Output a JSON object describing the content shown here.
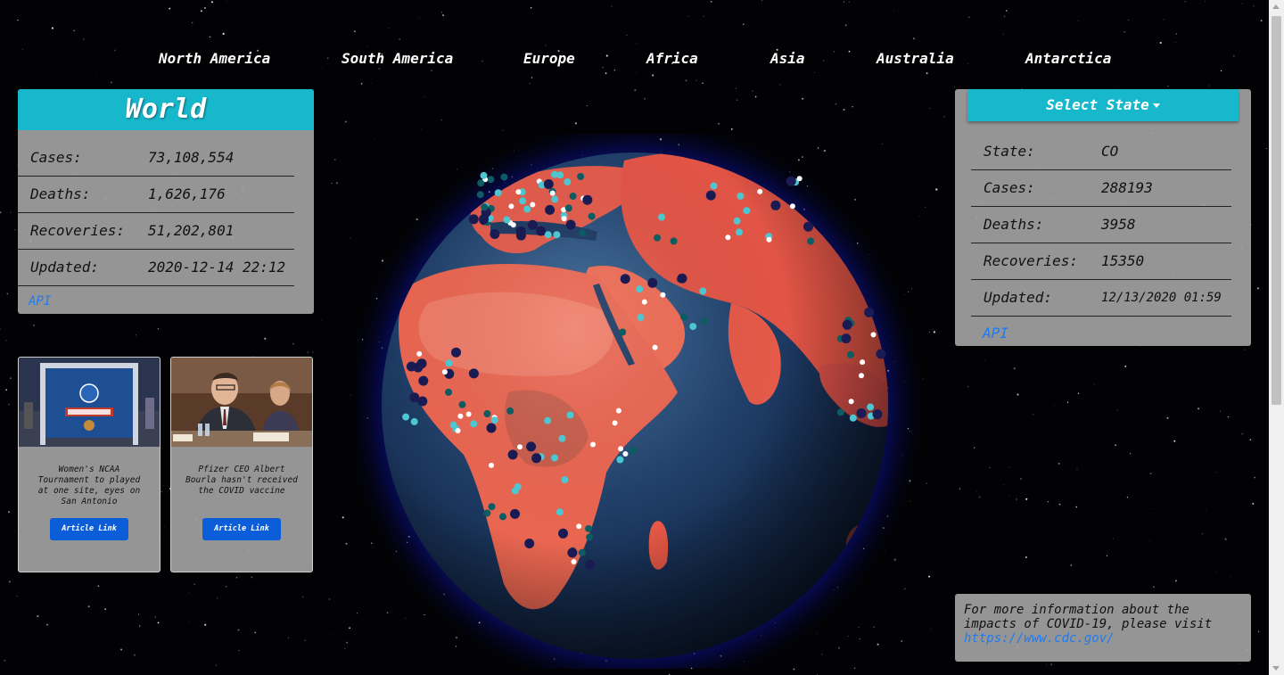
{
  "nav": {
    "items": [
      {
        "label": "North America"
      },
      {
        "label": "South America"
      },
      {
        "label": "Europe"
      },
      {
        "label": "Africa"
      },
      {
        "label": "Asia"
      },
      {
        "label": "Australia"
      },
      {
        "label": "Antarctica"
      }
    ]
  },
  "world": {
    "title": "World",
    "rows": [
      {
        "label": "Cases:",
        "value": "73,108,554"
      },
      {
        "label": "Deaths:",
        "value": "1,626,176"
      },
      {
        "label": "Recoveries:",
        "value": "51,202,801"
      },
      {
        "label": "Updated:",
        "value": "2020-12-14 22:12"
      }
    ],
    "api_label": "API"
  },
  "news": [
    {
      "caption": "Women's NCAA Tournament to played at one site, eyes on San Antonio",
      "button": "Article Link",
      "image": "final-four-image"
    },
    {
      "caption": "Pfizer CEO Albert Bourla hasn't received the COVID vaccine",
      "button": "Article Link",
      "image": "pfizer-ceo-image"
    }
  ],
  "state": {
    "select_label": "Select State",
    "rows": [
      {
        "label": "State:",
        "value": "CO"
      },
      {
        "label": "Cases:",
        "value": "288193"
      },
      {
        "label": "Deaths:",
        "value": "3958"
      },
      {
        "label": "Recoveries:",
        "value": "15350"
      },
      {
        "label": "Updated:",
        "value": "12/13/2020 01:59"
      }
    ],
    "api_label": "API"
  },
  "info": {
    "text": "For more information about the impacts of COVID-19, please visit",
    "link": "https://www.cdc.gov/"
  },
  "colors": {
    "accent": "#17b7cc",
    "link": "#1e7bf0",
    "button": "#0b5ed7",
    "land": "#e8584a",
    "ocean": "#1d3a63"
  }
}
